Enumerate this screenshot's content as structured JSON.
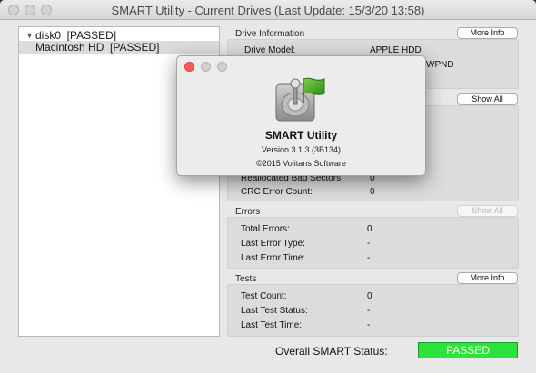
{
  "window": {
    "title": "SMART Utility - Current Drives (Last Update: 15/3/20 13:58)"
  },
  "tree": {
    "items": [
      {
        "label": "disk0  [PASSED]",
        "expanded": true
      },
      {
        "label": "Macintosh HD  [PASSED]",
        "selected": true
      }
    ]
  },
  "drive_info": {
    "title": "Drive Information",
    "button": "More Info",
    "model_label": "Drive Model:",
    "model_value": "APPLE HDD",
    "serial_partial": "WPND"
  },
  "attributes": {
    "button": "Show All",
    "reallocated_label": "Reallocated Bad Sectors:",
    "reallocated_value": "0",
    "crc_label": "CRC Error Count:",
    "crc_value": "0"
  },
  "errors": {
    "title": "Errors",
    "button": "Show All",
    "rows": [
      {
        "label": "Total Errors:",
        "value": "0"
      },
      {
        "label": "Last Error Type:",
        "value": "-"
      },
      {
        "label": "Last Error Time:",
        "value": "-"
      }
    ]
  },
  "tests": {
    "title": "Tests",
    "button": "More Info",
    "rows": [
      {
        "label": "Test Count:",
        "value": "0"
      },
      {
        "label": "Last Test Status:",
        "value": "-"
      },
      {
        "label": "Last Test Time:",
        "value": "-"
      }
    ]
  },
  "overall": {
    "label": "Overall SMART Status:",
    "status": "PASSED",
    "status_color": "#2be33a"
  },
  "about": {
    "app_name": "SMART Utility",
    "version": "Version 3.1.3 (3B134)",
    "copyright": "©2015 Volitans Software",
    "icon": "hard-drive-joystick-flag-icon"
  }
}
